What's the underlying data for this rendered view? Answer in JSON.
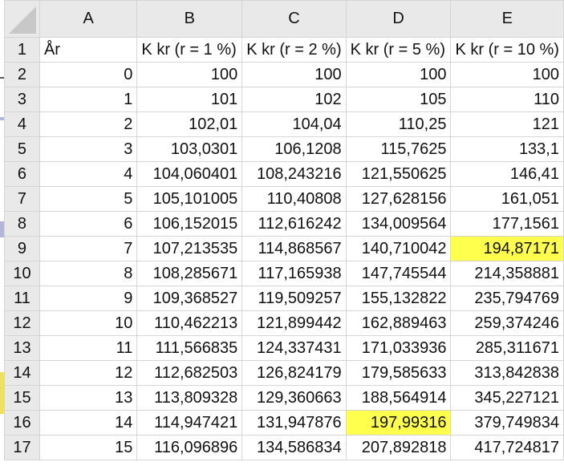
{
  "columns": [
    "A",
    "B",
    "C",
    "D",
    "E"
  ],
  "rows": [
    {
      "num": "1",
      "cells": [
        "År",
        "K kr (r = 1 %)",
        "K kr (r = 2 %)",
        "K kr (r = 5 %)",
        "K kr (r = 10 %)"
      ]
    },
    {
      "num": "2",
      "cells": [
        "0",
        "100",
        "100",
        "100",
        "100"
      ]
    },
    {
      "num": "3",
      "cells": [
        "1",
        "101",
        "102",
        "105",
        "110"
      ]
    },
    {
      "num": "4",
      "cells": [
        "2",
        "102,01",
        "104,04",
        "110,25",
        "121"
      ]
    },
    {
      "num": "5",
      "cells": [
        "3",
        "103,0301",
        "106,1208",
        "115,7625",
        "133,1"
      ]
    },
    {
      "num": "6",
      "cells": [
        "4",
        "104,060401",
        "108,243216",
        "121,550625",
        "146,41"
      ]
    },
    {
      "num": "7",
      "cells": [
        "5",
        "105,101005",
        "110,40808",
        "127,628156",
        "161,051"
      ]
    },
    {
      "num": "8",
      "cells": [
        "6",
        "106,152015",
        "112,616242",
        "134,009564",
        "177,1561"
      ]
    },
    {
      "num": "9",
      "cells": [
        "7",
        "107,213535",
        "114,868567",
        "140,710042",
        "194,87171"
      ]
    },
    {
      "num": "10",
      "cells": [
        "8",
        "108,285671",
        "117,165938",
        "147,745544",
        "214,358881"
      ]
    },
    {
      "num": "11",
      "cells": [
        "9",
        "109,368527",
        "119,509257",
        "155,132822",
        "235,794769"
      ]
    },
    {
      "num": "12",
      "cells": [
        "10",
        "110,462213",
        "121,899442",
        "162,889463",
        "259,374246"
      ]
    },
    {
      "num": "13",
      "cells": [
        "11",
        "111,566835",
        "124,337431",
        "171,033936",
        "285,311671"
      ]
    },
    {
      "num": "14",
      "cells": [
        "12",
        "112,682503",
        "126,824179",
        "179,585633",
        "313,842838"
      ]
    },
    {
      "num": "15",
      "cells": [
        "13",
        "113,809328",
        "129,360663",
        "188,564914",
        "345,227121"
      ]
    },
    {
      "num": "16",
      "cells": [
        "14",
        "114,947421",
        "131,947876",
        "197,99316",
        "379,749834"
      ]
    },
    {
      "num": "17",
      "cells": [
        "15",
        "116,096896",
        "134,586834",
        "207,892818",
        "417,724817"
      ]
    }
  ],
  "colors": {
    "highlight": "#ffff4d",
    "header_bg": "#e9e9e9",
    "grid": "#d4d4d4"
  },
  "highlighted_cells": [
    "E9",
    "D16"
  ]
}
